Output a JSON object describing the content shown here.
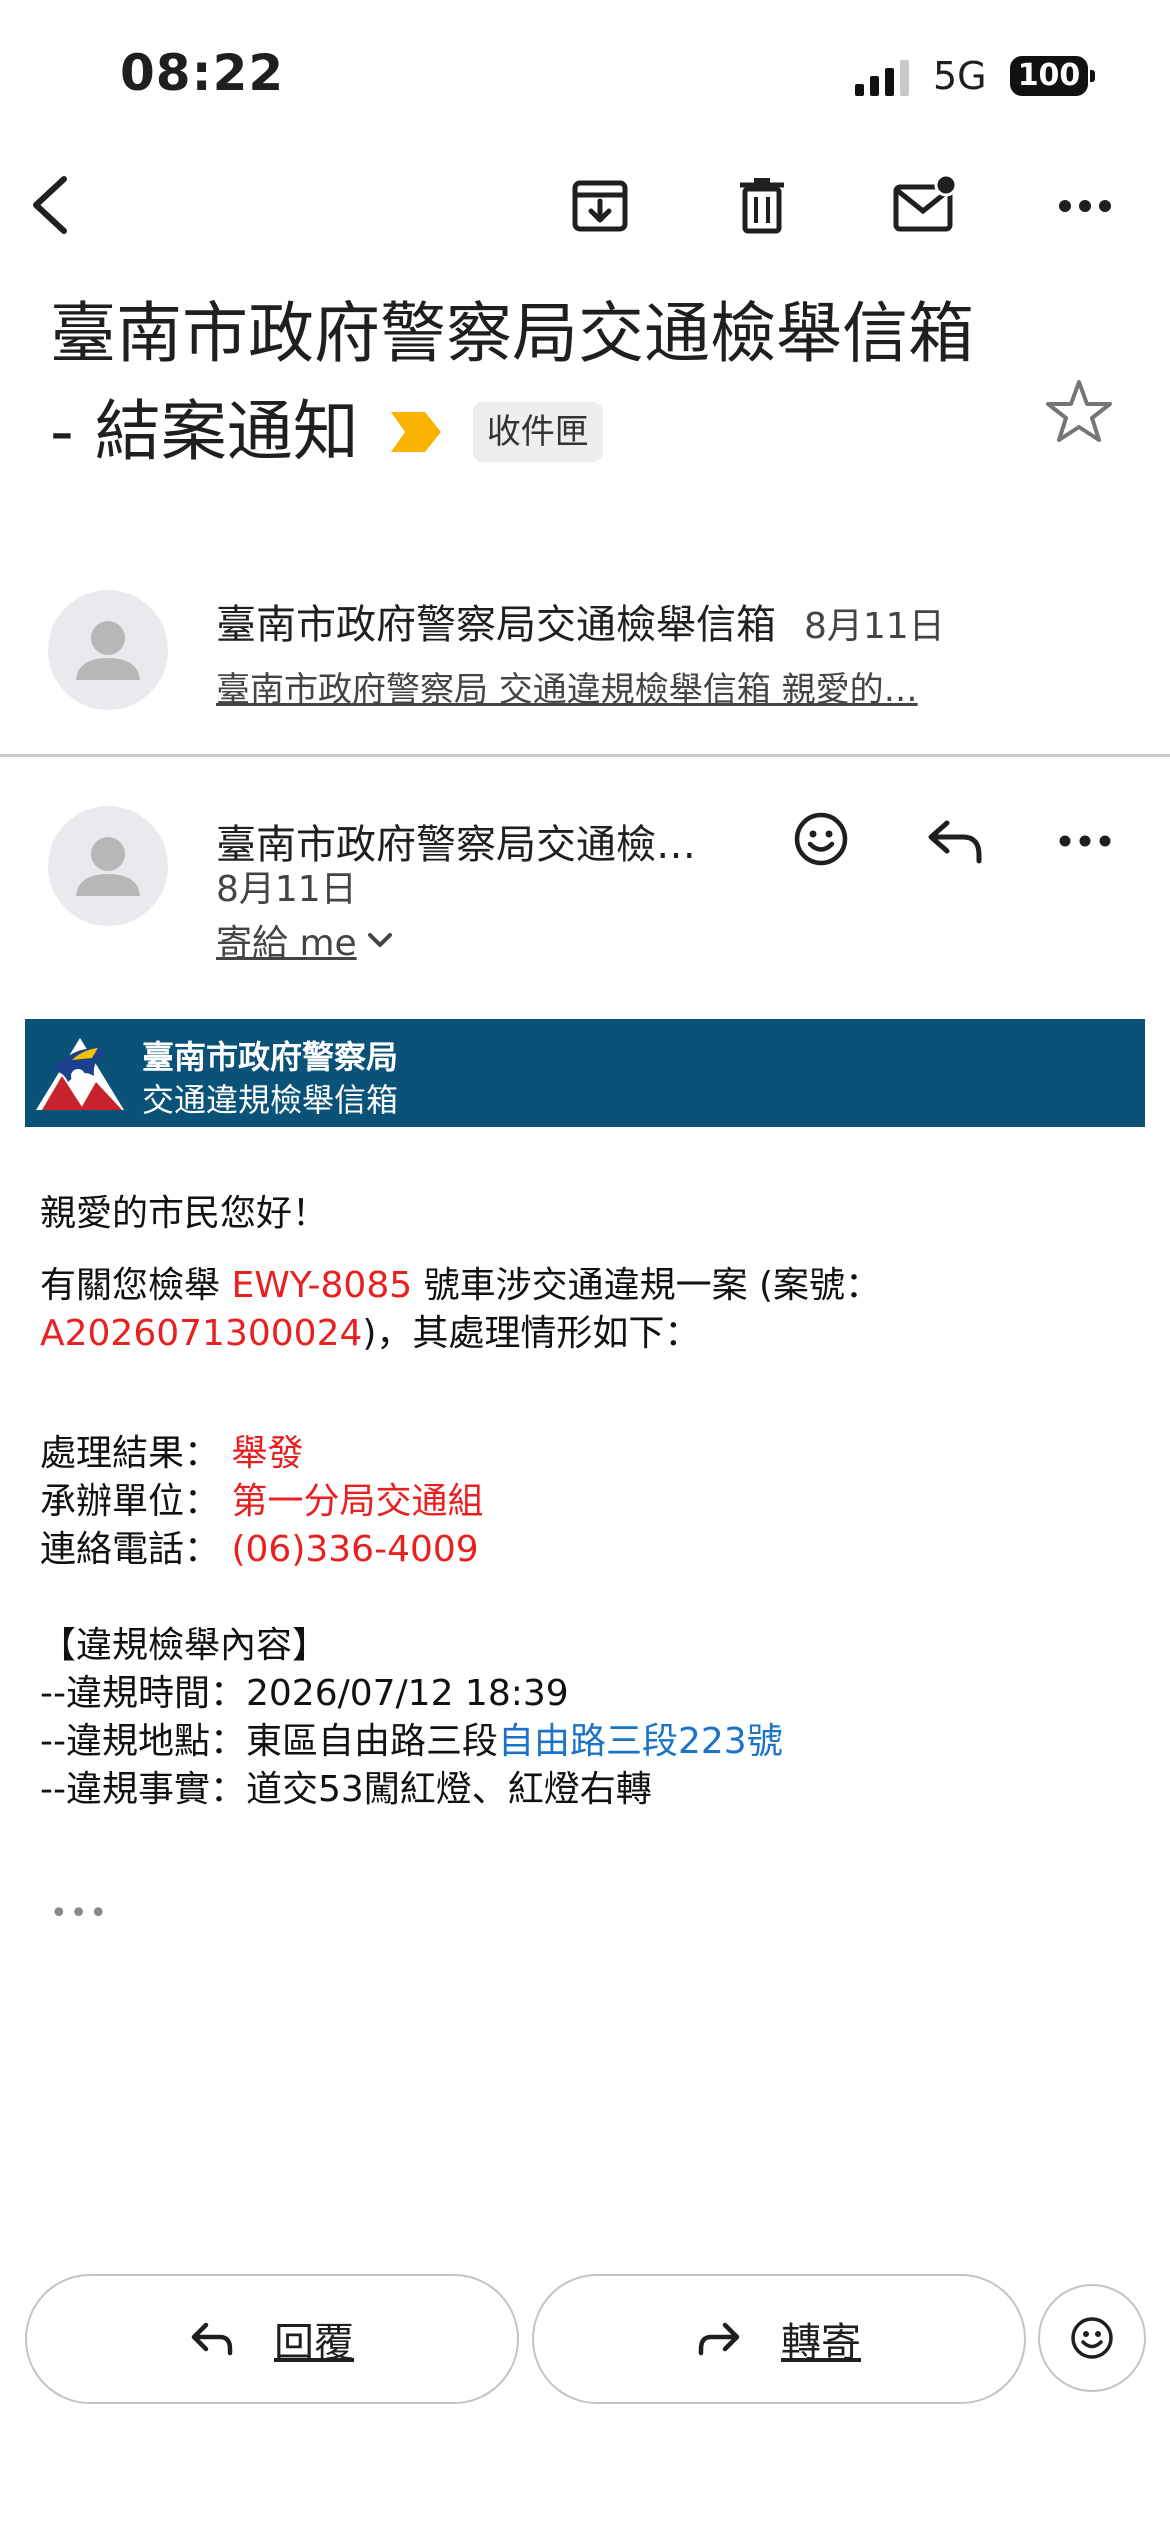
{
  "status_bar": {
    "time": "08:22",
    "network": "5G",
    "battery": "100"
  },
  "toolbar": {
    "back_icon": "back-arrow-icon",
    "archive_icon": "archive-icon",
    "delete_icon": "trash-icon",
    "mark_unread_icon": "mark-unread-icon",
    "more_icon": "more-horizontal-icon"
  },
  "subject": {
    "line1": "臺南市政府警察局交通檢舉信箱",
    "line2": "- 結案通知",
    "label": "收件匣",
    "important_color": "#f9b300"
  },
  "thread": [
    {
      "sender": "臺南市政府警察局交通檢舉信箱",
      "date": "8月11日",
      "snippet": "臺南市政府警察局 交通違規檢舉信箱 親愛的…"
    },
    {
      "sender": "臺南市政府警察局交通檢…",
      "date": "8月11日",
      "to": "寄給 me"
    }
  ],
  "banner": {
    "line1": "臺南市政府警察局",
    "line2": "交通違規檢舉信箱",
    "bg": "#0b5279"
  },
  "message": {
    "greeting": "親愛的市民您好！",
    "intro_pre": "有關您檢舉 ",
    "plate": "EWY-8085",
    "intro_post": " 號車涉交通違規一案 (案號：",
    "case_no": "A2026071300024",
    "intro_end": ")，其處理情形如下：",
    "result_label": "處理結果：",
    "result_value": "舉發",
    "unit_label": "承辦單位：",
    "unit_value": "第一分局交通組",
    "phone_label": "連絡電話：",
    "phone_value": "(06)336-4009",
    "section_title": "【違規檢舉內容】",
    "time_label": "--違規時間：",
    "time_value": "2026/07/12 18:39",
    "place_label": "--違規地點：",
    "place_value": "東區自由路三段",
    "place_link": "自由路三段223號",
    "fact_label": "--違規事實：",
    "fact_value": "道交53闖紅燈、紅燈右轉",
    "trimmed": "•••"
  },
  "actions": {
    "reply": "回覆",
    "forward": "轉寄"
  },
  "colors": {
    "accent_red": "#e8201f",
    "link_blue": "#1a73c8"
  }
}
